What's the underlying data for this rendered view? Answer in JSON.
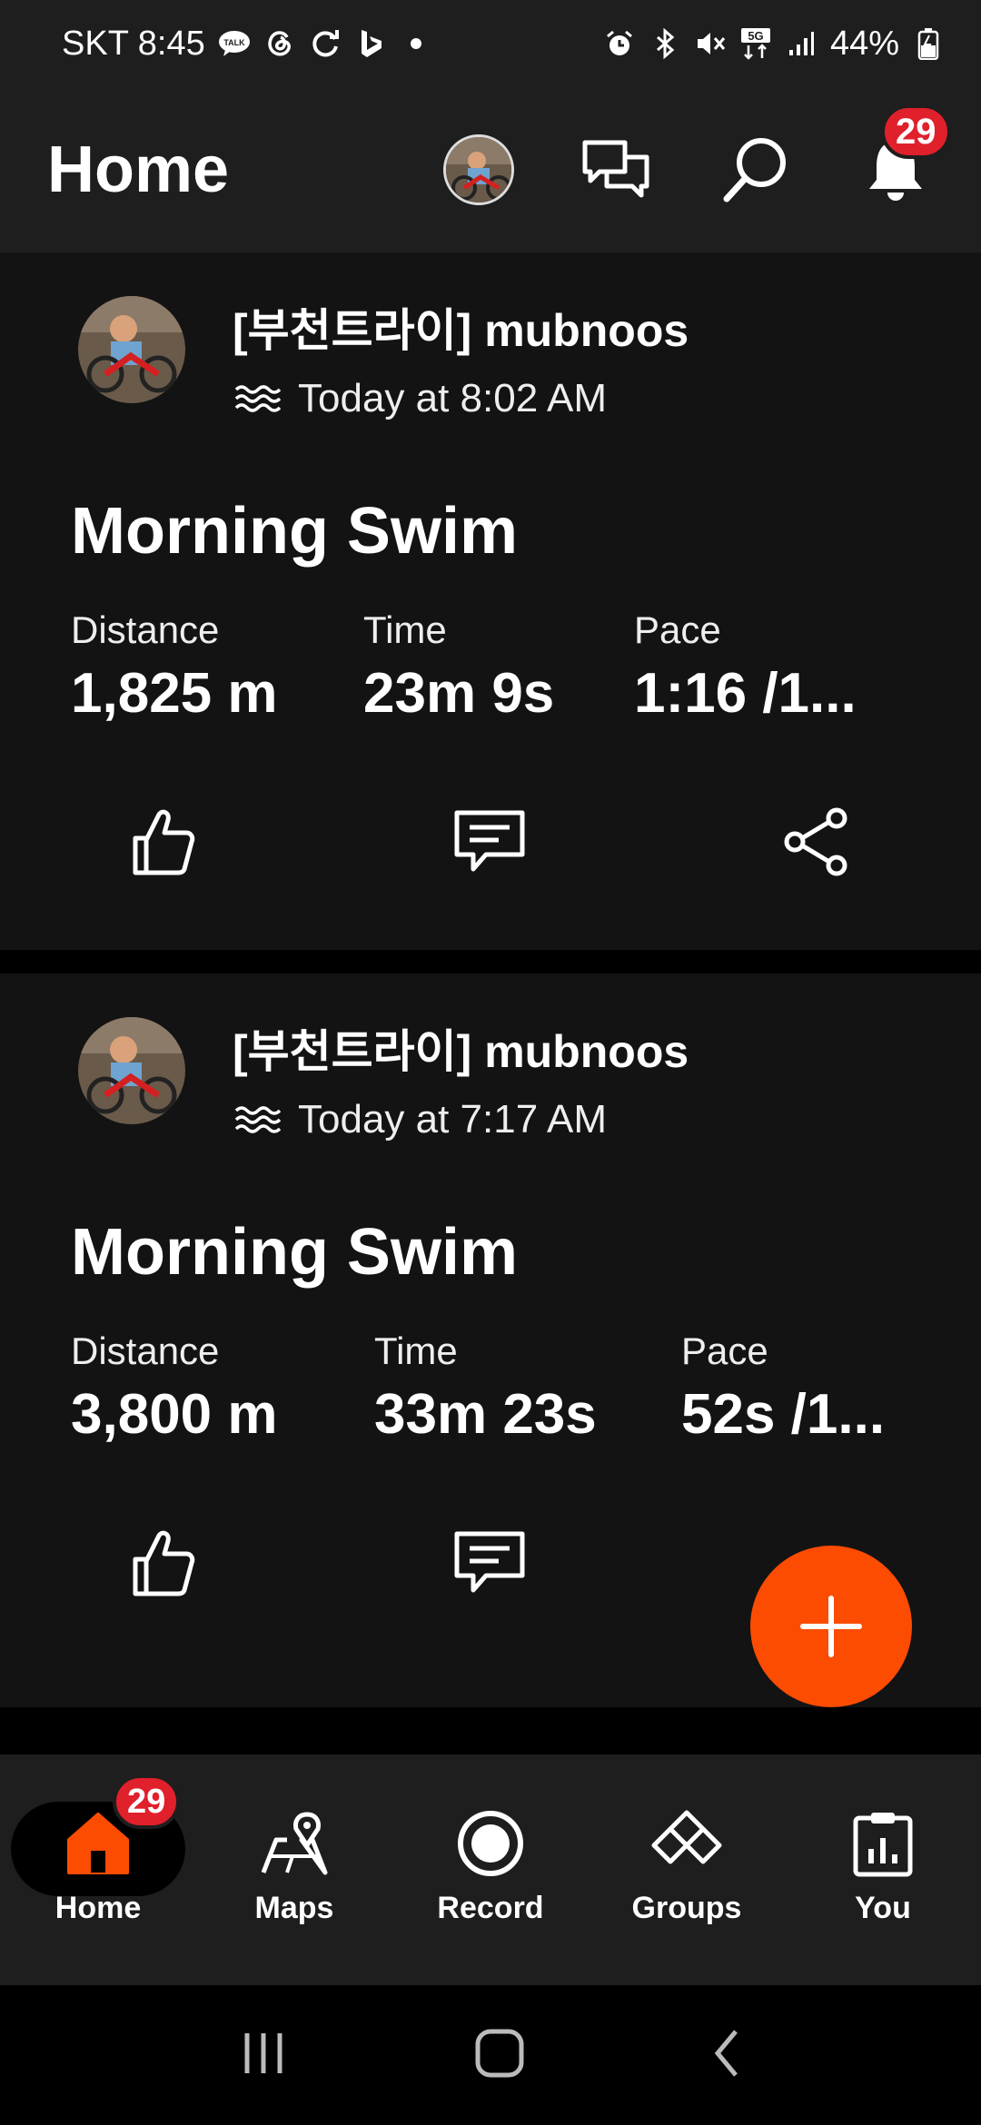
{
  "status_bar": {
    "carrier_time": "SKT 8:45",
    "battery": "44%",
    "network": "5G"
  },
  "header": {
    "title": "Home",
    "notification_count": "29"
  },
  "feed": [
    {
      "athlete": "[부천트라이] mubnoos",
      "timestamp": "Today at 8:02 AM",
      "activity_type": "swim",
      "title": "Morning Swim",
      "stats": [
        {
          "label": "Distance",
          "value": "1,825 m"
        },
        {
          "label": "Time",
          "value": "23m 9s"
        },
        {
          "label": "Pace",
          "value": "1:16 /1..."
        }
      ]
    },
    {
      "athlete": "[부천트라이] mubnoos",
      "timestamp": "Today at 7:17 AM",
      "activity_type": "swim",
      "title": "Morning Swim",
      "stats": [
        {
          "label": "Distance",
          "value": "3,800 m"
        },
        {
          "label": "Time",
          "value": "33m 23s"
        },
        {
          "label": "Pace",
          "value": "52s /1..."
        }
      ]
    }
  ],
  "bottom_nav": {
    "items": [
      {
        "label": "Home",
        "icon": "home-icon",
        "active": true,
        "badge": "29"
      },
      {
        "label": "Maps",
        "icon": "maps-icon"
      },
      {
        "label": "Record",
        "icon": "record-icon"
      },
      {
        "label": "Groups",
        "icon": "groups-icon"
      },
      {
        "label": "You",
        "icon": "you-icon"
      }
    ]
  },
  "colors": {
    "accent": "#fc4c02",
    "badge": "#e0202b",
    "card_bg": "#131313",
    "bar_bg": "#1e1e1e"
  }
}
